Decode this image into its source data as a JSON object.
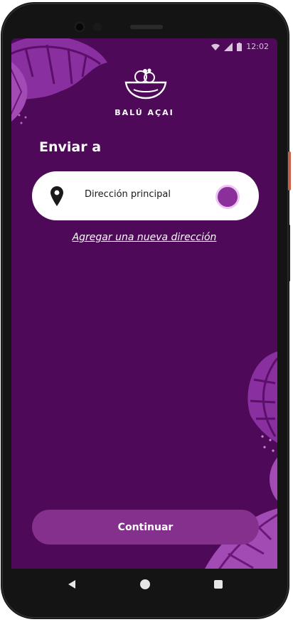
{
  "status_bar": {
    "time": "12:02"
  },
  "brand": {
    "name": "BALÚ AÇAI"
  },
  "page": {
    "title": "Enviar a"
  },
  "address": {
    "label": "Dirección principal",
    "selected": true
  },
  "links": {
    "add_address": "Agregar una nueva dirección"
  },
  "actions": {
    "continue_label": "Continuar"
  },
  "colors": {
    "background": "#4e0a59",
    "card": "#ffffff",
    "accent": "#86308e",
    "radio_fill": "#8b2f9a",
    "leaf": "#a24bb5"
  },
  "icons": {
    "location": "map-pin-icon",
    "logo": "acai-bowl-logo-icon",
    "nav_back": "back-triangle-icon",
    "nav_home": "home-circle-icon",
    "nav_recent": "recent-square-icon"
  }
}
